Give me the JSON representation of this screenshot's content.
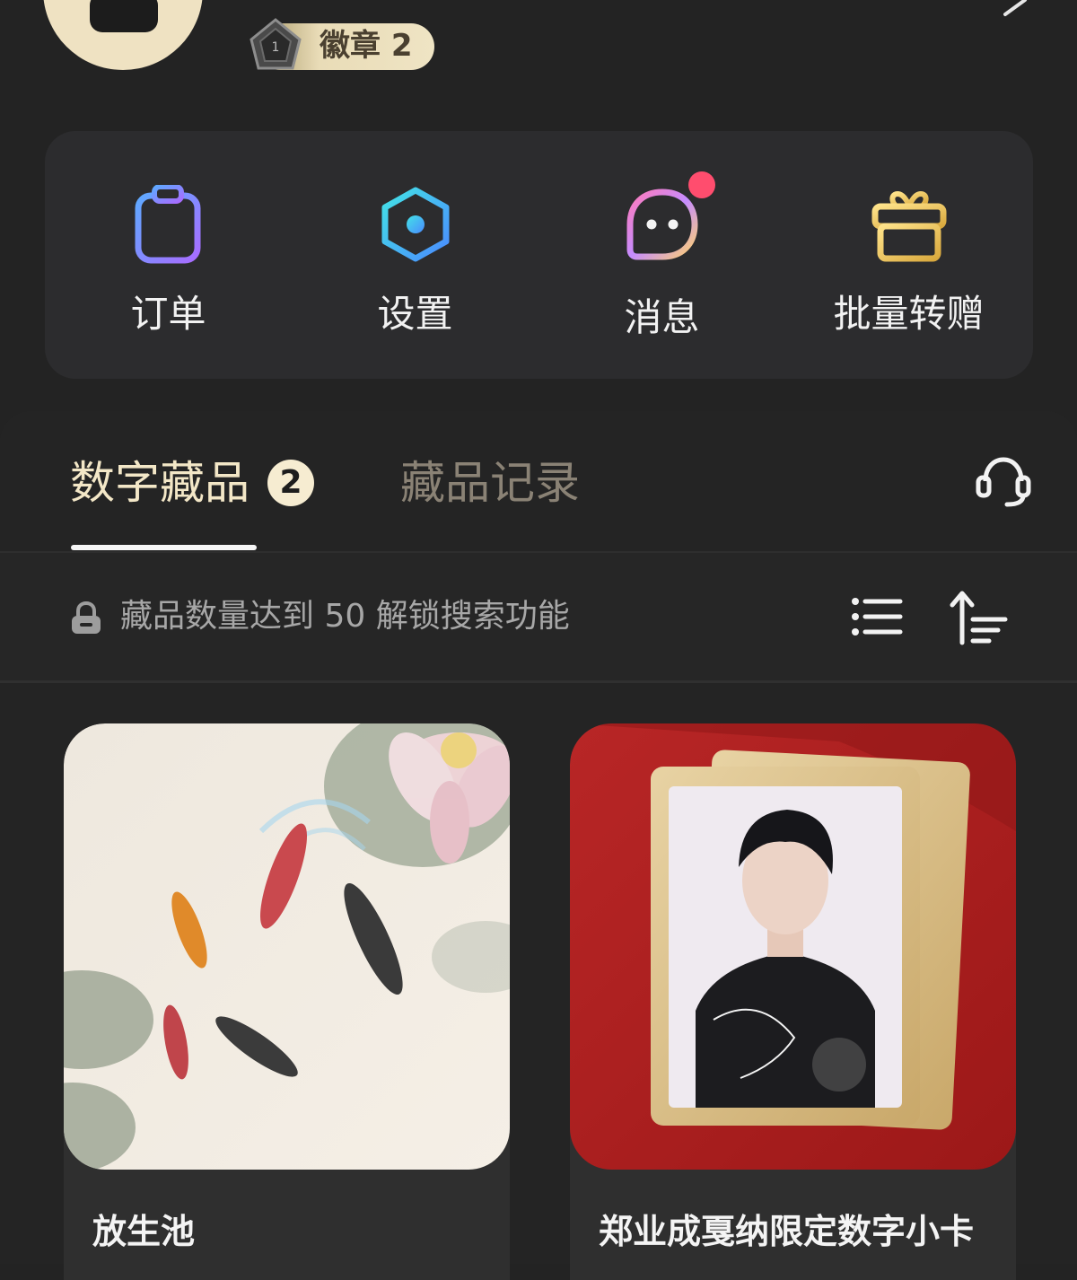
{
  "profile": {
    "badge_label": "徽章 2",
    "badge_medal_number": "1"
  },
  "actions": [
    {
      "label": "订单",
      "icon": "clipboard-icon"
    },
    {
      "label": "设置",
      "icon": "settings-hexagon-icon"
    },
    {
      "label": "消息",
      "icon": "message-face-icon",
      "has_notification": true
    },
    {
      "label": "批量转赠",
      "icon": "gift-icon"
    }
  ],
  "tabs": {
    "primary_label": "数字藏品",
    "primary_count": "2",
    "secondary_label": "藏品记录"
  },
  "filter": {
    "hint": "藏品数量达到 50 解锁搜索功能"
  },
  "cards": [
    {
      "title": "放生池",
      "image": "koi-pond-lotus-artwork"
    },
    {
      "title": "郑业成戛纳限定数字小卡",
      "image": "signed-portrait-photo-card"
    }
  ],
  "colors": {
    "background": "#232323",
    "panel": "#2c2c2e",
    "accent_gold": "#efe2c2",
    "notification": "#ff4d6e"
  }
}
